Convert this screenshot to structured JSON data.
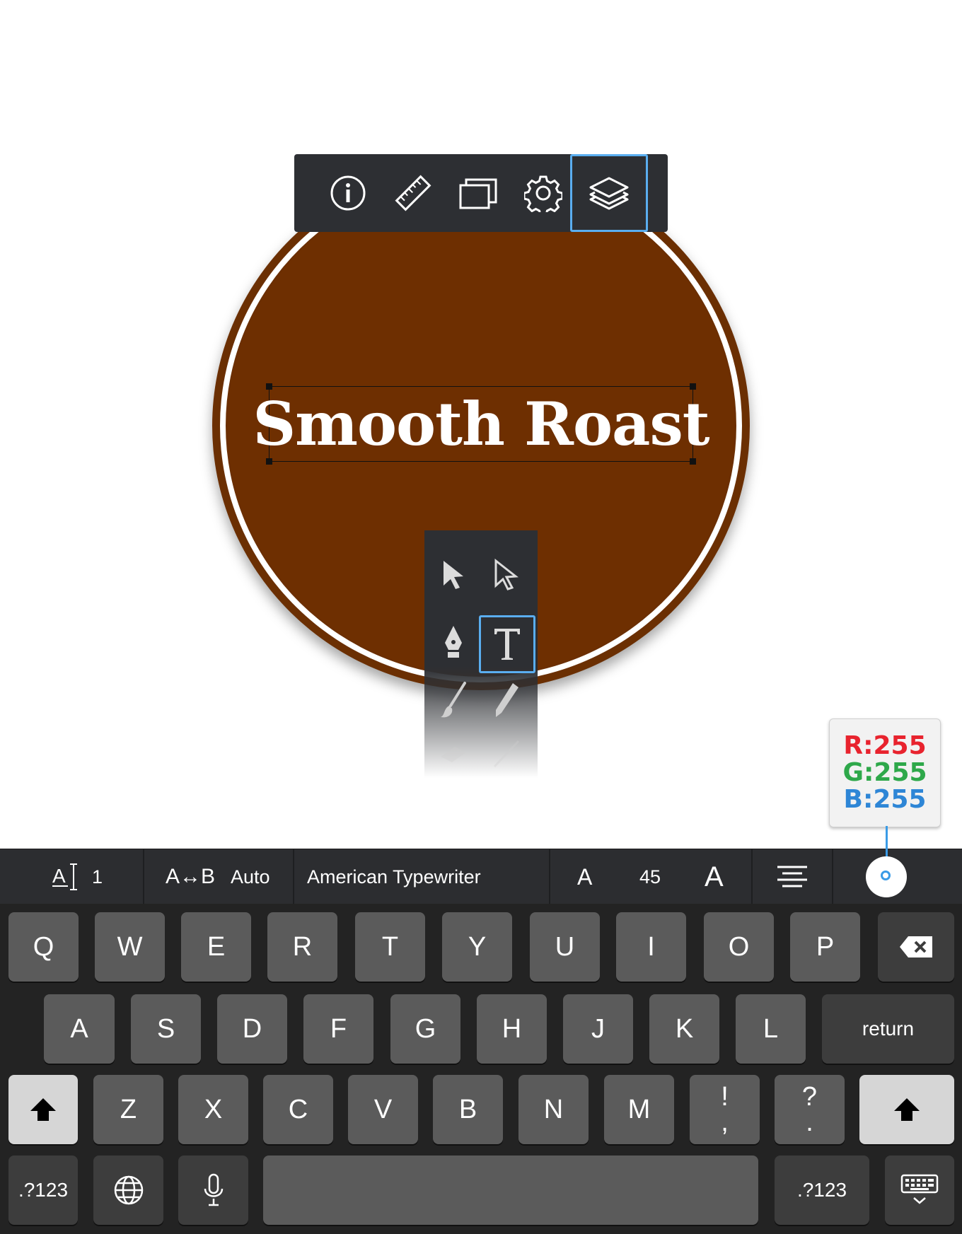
{
  "canvas": {
    "headline_text": "Smooth Roast",
    "badge_color": "#6e2f01",
    "selection_color": "#5aaef0"
  },
  "top_toolbar": {
    "buttons": [
      {
        "name": "info",
        "icon": "info-icon"
      },
      {
        "name": "ruler",
        "icon": "ruler-icon"
      },
      {
        "name": "artboards",
        "icon": "artboards-icon"
      },
      {
        "name": "settings",
        "icon": "gear-icon"
      },
      {
        "name": "layers",
        "icon": "layers-icon",
        "active": true
      }
    ]
  },
  "tool_palette": {
    "tools": [
      {
        "name": "select",
        "icon": "arrow-solid-icon"
      },
      {
        "name": "direct-select",
        "icon": "arrow-outline-icon"
      },
      {
        "name": "pen",
        "icon": "pen-nib-icon"
      },
      {
        "name": "text",
        "icon": "text-tool-icon",
        "active": true
      },
      {
        "name": "brush",
        "icon": "brush-icon"
      },
      {
        "name": "pencil",
        "icon": "pencil-icon"
      },
      {
        "name": "eraser",
        "icon": "eraser-icon"
      },
      {
        "name": "line",
        "icon": "line-icon"
      }
    ]
  },
  "color_readout": {
    "r": "R:255",
    "g": "G:255",
    "b": "B:255"
  },
  "format_bar": {
    "line_spacing_value": "1",
    "letter_spacing_icon_label": "A↔B",
    "letter_spacing_value": "Auto",
    "font_name": "American Typewriter",
    "font_size_small_a": "A",
    "font_size": "45",
    "font_size_large_a": "A",
    "text_color": "#ffffff"
  },
  "keyboard": {
    "row1": [
      "Q",
      "W",
      "E",
      "R",
      "T",
      "Y",
      "U",
      "I",
      "O",
      "P"
    ],
    "row2": [
      "A",
      "S",
      "D",
      "F",
      "G",
      "H",
      "J",
      "K",
      "L"
    ],
    "row3": [
      "Z",
      "X",
      "C",
      "V",
      "B",
      "N",
      "M"
    ],
    "exclam_top": "!",
    "exclam_bottom": ",",
    "question_top": "?",
    "question_bottom": ".",
    "return_label": "return",
    "numbers_label": ".?123"
  }
}
